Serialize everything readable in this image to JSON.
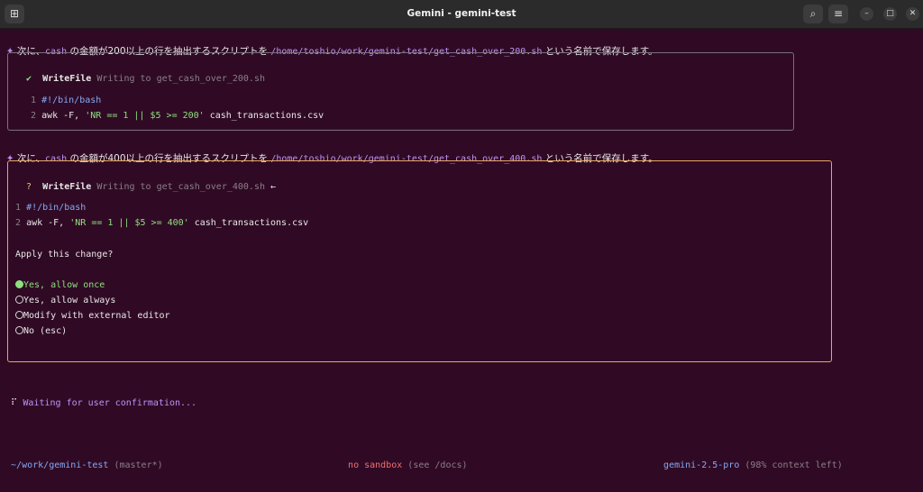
{
  "window": {
    "title": "Gemini - gemini-test"
  },
  "messages": [
    {
      "sparkle": "✦",
      "pre": " 次に、",
      "code": "cash",
      "mid": " の金額が200以上の行を抽出するスクリプトを ",
      "path": "/home/toshio/work/gemini-test/get_cash_over_200.sh",
      "post": " という名前で保存します。"
    },
    {
      "sparkle": "✦",
      "pre": " 次に、",
      "code": "cash",
      "mid": " の金額が400以上の行を抽出するスクリプトを ",
      "path": "/home/toshio/work/gemini-test/get_cash_over_400.sh",
      "post": " という名前で保存します。"
    }
  ],
  "tool1": {
    "status": "✔",
    "name": "WriteFile",
    "desc": "Writing to get_cash_over_200.sh",
    "lines": [
      {
        "num": "1",
        "parts": [
          "#!/bin/bash"
        ]
      },
      {
        "num": "2",
        "a": "awk -F, ",
        "s": "'NR == 1 || $5 >= 200'",
        "b": " cash_transactions.csv"
      }
    ]
  },
  "tool2": {
    "status": "?",
    "name": "WriteFile",
    "desc": "Writing to get_cash_over_400.sh",
    "arrow": "←",
    "lines": [
      {
        "num": "1",
        "text": "#!/bin/bash"
      },
      {
        "num": "2",
        "a": "awk -F, ",
        "s": "'NR == 1 || $5 >= 400'",
        "b": " cash_transactions.csv"
      }
    ],
    "question": "Apply this change?",
    "options": [
      {
        "label": "Yes, allow once",
        "selected": true
      },
      {
        "label": "Yes, allow always",
        "selected": false
      },
      {
        "label": "Modify with external editor",
        "selected": false
      },
      {
        "label": "No (esc)",
        "selected": false
      }
    ]
  },
  "status": {
    "spinner": "⠏",
    "waiting": "Waiting for user confirmation..."
  },
  "footer": {
    "cwd": "~/work/gemini-test",
    "branch": "(master*)",
    "sandbox": "no sandbox",
    "sandbox_hint": "(see /docs)",
    "model": "gemini-2.5-pro",
    "context": "(98% context left)"
  },
  "colors": {
    "background": "#300a24",
    "accent": "#bd93f9",
    "string": "#8ee07f",
    "warn_border": "#e8a863"
  }
}
